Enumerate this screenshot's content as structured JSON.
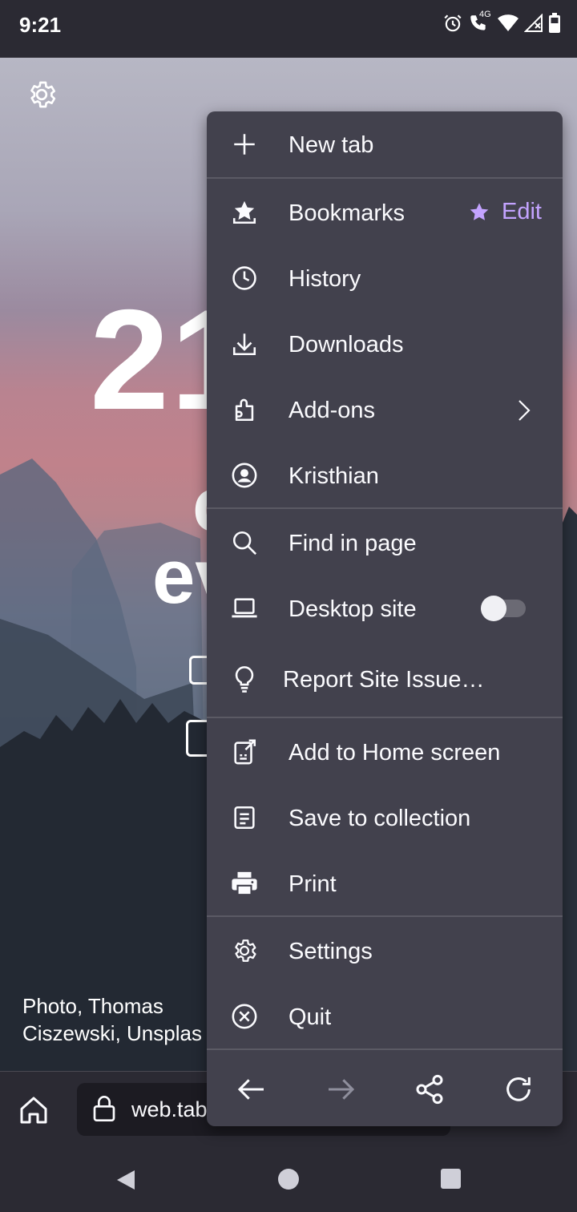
{
  "status_bar": {
    "time": "9:21",
    "network": "4G"
  },
  "wallpaper": {
    "big_number": "21",
    "fragment_c": "c",
    "fragment_ev": "ev",
    "credit": "Photo, Thomas Ciszewski, Unsplas"
  },
  "toolbar": {
    "url": "web.tab"
  },
  "menu": {
    "new_tab": "New tab",
    "bookmarks": "Bookmarks",
    "bookmarks_edit": "Edit",
    "history": "History",
    "downloads": "Downloads",
    "addons": "Add-ons",
    "account": "Kristhian",
    "find_in_page": "Find in page",
    "desktop_site": "Desktop site",
    "desktop_site_enabled": false,
    "report_issue": "Report Site Issue…",
    "add_home": "Add to Home screen",
    "save_collection": "Save to collection",
    "print": "Print",
    "settings": "Settings",
    "quit": "Quit"
  },
  "colors": {
    "menu_bg": "#42414d",
    "accent": "#c3a3ff",
    "text": "#fbfbfe",
    "chrome_bg": "#2b2a33"
  }
}
